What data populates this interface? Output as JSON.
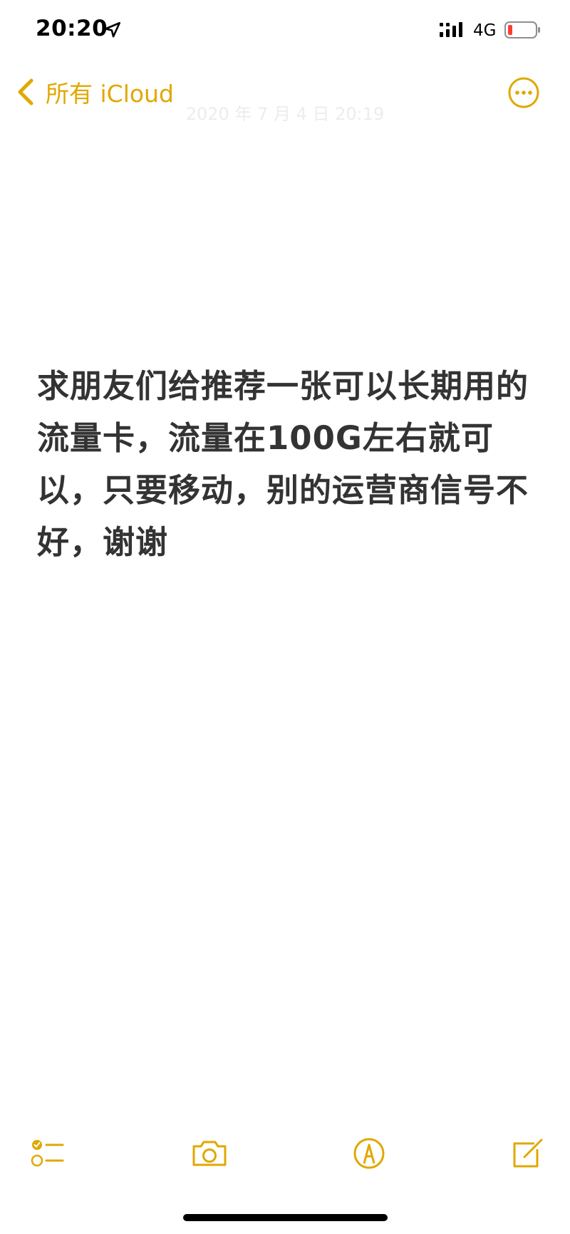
{
  "status_bar": {
    "time": "20:20",
    "network": "4G",
    "battery_color": "#ff3b30"
  },
  "nav": {
    "back_label": "所有 iCloud",
    "faded_date": "2020 年 7 月 4 日 20:19"
  },
  "note": {
    "text": "求朋友们给推荐一张可以长期用的流量卡，流量在100G左右就可以，只要移动，别的运营商信号不好，谢谢"
  },
  "toolbar": {
    "icons": [
      "checklist-icon",
      "camera-icon",
      "markup-icon",
      "compose-icon"
    ]
  },
  "colors": {
    "accent": "#e0a800",
    "text": "#333333",
    "background": "#ffffff"
  }
}
